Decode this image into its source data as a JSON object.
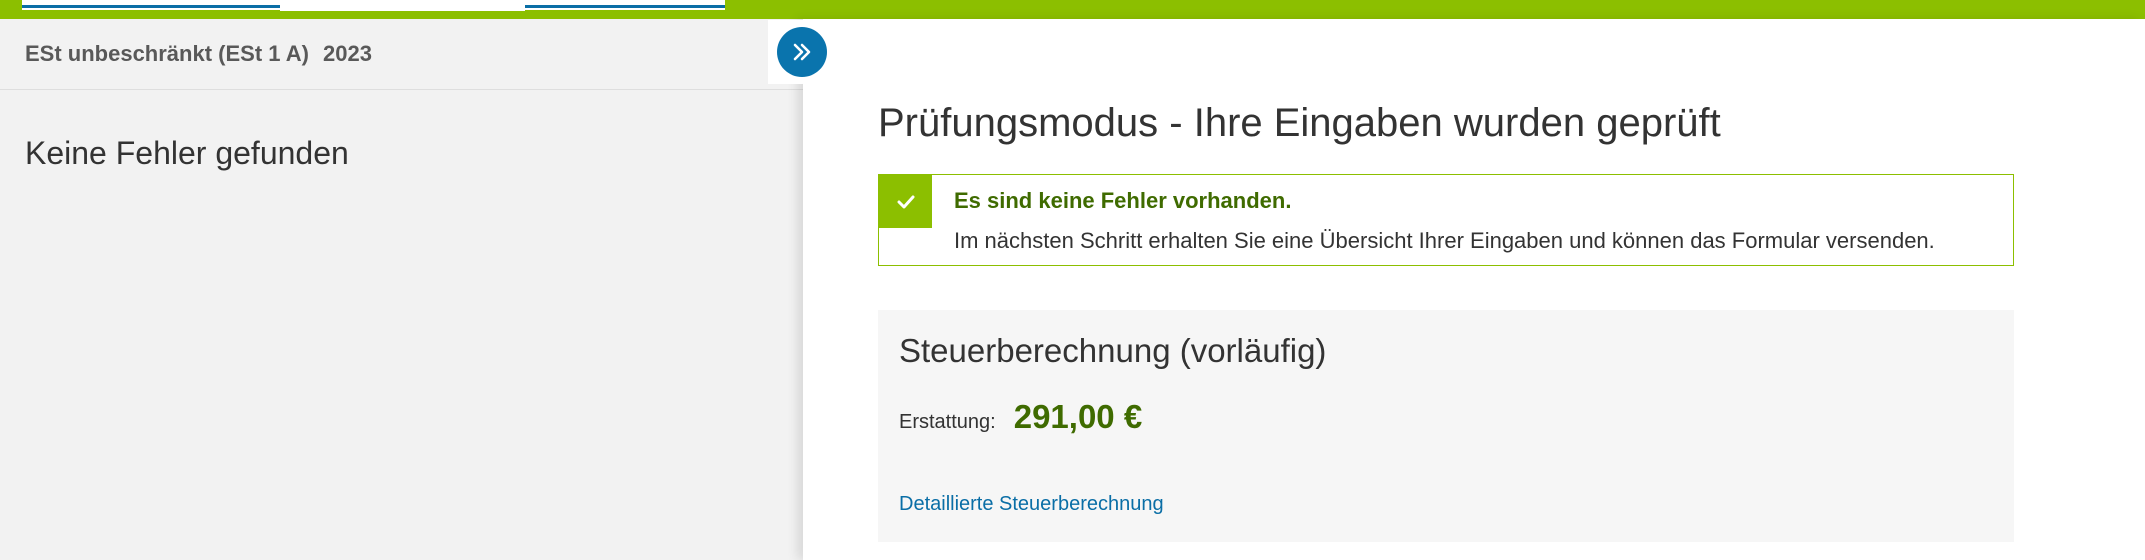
{
  "left_panel": {
    "form_name": "ESt unbeschränkt (ESt 1 A)",
    "year": "2023",
    "message": "Keine Fehler gefunden"
  },
  "toggle": {
    "icon": "double-chevron-right-icon"
  },
  "main": {
    "title": "Prüfungsmodus - Ihre Eingaben wurden geprüft",
    "success": {
      "icon": "checkmark-icon",
      "title": "Es sind keine Fehler vorhanden.",
      "text": "Im nächsten Schritt erhalten Sie eine Übersicht Ihrer Eingaben und können das Formular versenden."
    },
    "tax": {
      "title": "Steuerberechnung (vorläufig)",
      "label": "Erstattung:",
      "amount": "291,00 €",
      "link": "Detaillierte Steuerberechnung"
    }
  },
  "colors": {
    "accent_green": "#8cbf00",
    "dark_green": "#3f6b00",
    "link_blue": "#0a6ea6",
    "button_blue": "#0a74ad"
  }
}
